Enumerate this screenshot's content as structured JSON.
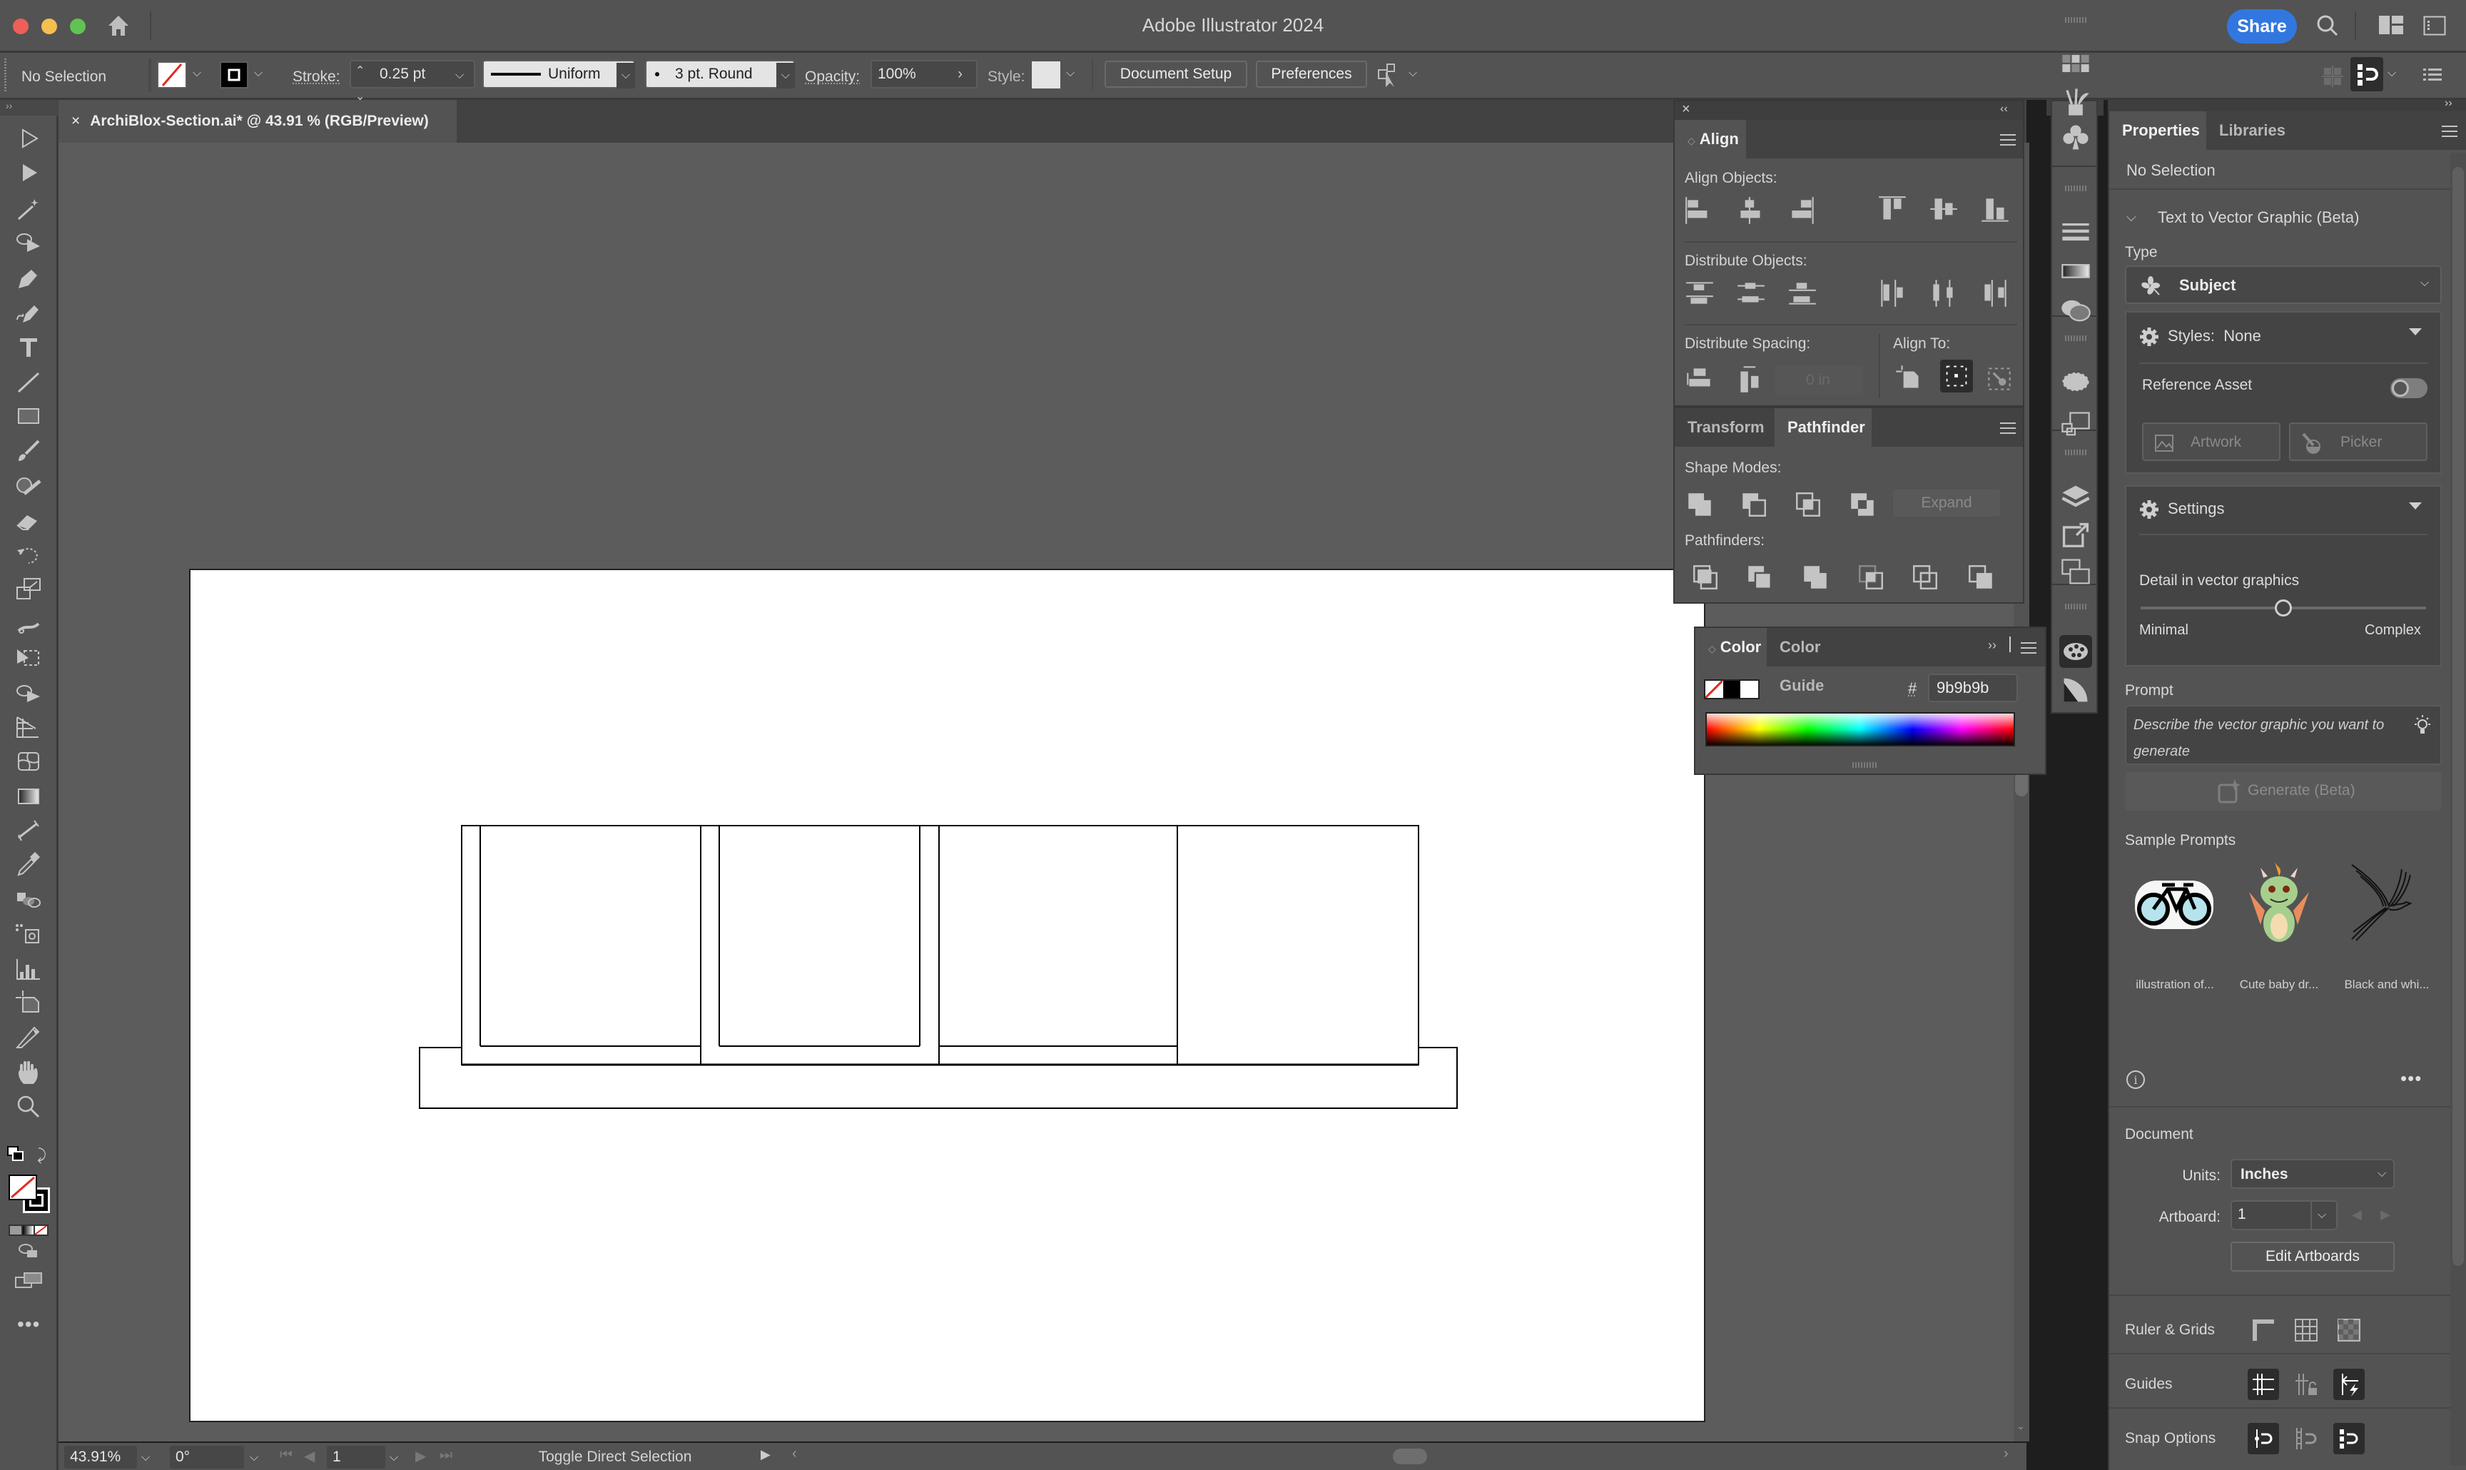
{
  "app": {
    "title": "Adobe Illustrator 2024",
    "share_label": "Share"
  },
  "control_bar": {
    "selection_status": "No Selection",
    "stroke_label": "Stroke:",
    "stroke_weight": "0.25 pt",
    "stroke_profile": "Uniform",
    "brush": "3 pt. Round",
    "opacity_label": "Opacity:",
    "opacity_value": "100%",
    "style_label": "Style:",
    "document_setup_label": "Document Setup",
    "preferences_label": "Preferences"
  },
  "document_tab": {
    "close_glyph": "×",
    "title": "ArchiBlox-Section.ai* @ 43.91 % (RGB/Preview)"
  },
  "tools": [
    {
      "name": "selection-tool"
    },
    {
      "name": "direct-selection-tool"
    },
    {
      "name": "magic-wand-tool"
    },
    {
      "name": "lasso-tool"
    },
    {
      "name": "pen-tool"
    },
    {
      "name": "curvature-tool"
    },
    {
      "name": "type-tool"
    },
    {
      "name": "line-segment-tool"
    },
    {
      "name": "rectangle-tool"
    },
    {
      "name": "paintbrush-tool"
    },
    {
      "name": "shaper-tool"
    },
    {
      "name": "eraser-tool"
    },
    {
      "name": "rotate-tool"
    },
    {
      "name": "scale-tool"
    },
    {
      "name": "puppet-warp-tool"
    },
    {
      "name": "free-transform-tool"
    },
    {
      "name": "shape-builder-tool"
    },
    {
      "name": "perspective-grid-tool"
    },
    {
      "name": "mesh-tool"
    },
    {
      "name": "gradient-tool"
    },
    {
      "name": "measure-tool"
    },
    {
      "name": "eyedropper-tool"
    },
    {
      "name": "blend-tool"
    },
    {
      "name": "symbol-sprayer-tool"
    },
    {
      "name": "column-graph-tool"
    },
    {
      "name": "artboard-tool"
    },
    {
      "name": "slice-tool"
    },
    {
      "name": "hand-tool"
    },
    {
      "name": "zoom-tool"
    }
  ],
  "status_bar": {
    "zoom": "43.91%",
    "rotation": "0°",
    "artboard_number": "1",
    "current_tool_hint": "Toggle Direct Selection"
  },
  "align_panel": {
    "tab_label": "Align",
    "align_objects_label": "Align Objects:",
    "distribute_objects_label": "Distribute Objects:",
    "distribute_spacing_label": "Distribute Spacing:",
    "spacing_value": "0 in",
    "align_to_label": "Align To:"
  },
  "pathfinder_panel": {
    "tabs": [
      "Transform",
      "Pathfinder"
    ],
    "active_tab": "Pathfinder",
    "shape_modes_label": "Shape Modes:",
    "expand_label": "Expand",
    "pathfinders_label": "Pathfinders:"
  },
  "color_panel": {
    "tabs": [
      "Color",
      "Color Guide"
    ],
    "active_tab": "Color",
    "hash_label": "#",
    "hex_value": "9b9b9b"
  },
  "properties_panel": {
    "tabs": [
      "Properties",
      "Libraries"
    ],
    "active_tab": "Properties",
    "selection_status": "No Selection",
    "text_to_vector": {
      "section_title": "Text to Vector Graphic (Beta)",
      "type_label": "Type",
      "type_value": "Subject",
      "styles_label": "Styles:",
      "styles_value": "None",
      "reference_asset_label": "Reference Asset",
      "reference_asset_enabled": false,
      "artwork_label": "Artwork",
      "picker_label": "Picker",
      "settings_label": "Settings",
      "detail_label": "Detail in vector graphics",
      "detail_min_label": "Minimal",
      "detail_max_label": "Complex",
      "detail_value": 0.5,
      "prompt_label": "Prompt",
      "prompt_placeholder": "Describe the vector graphic you want to generate",
      "generate_label": "Generate (Beta)",
      "sample_prompts_label": "Sample Prompts",
      "sample_prompts": [
        {
          "caption": "illustration of...",
          "icon": "bicycle-icon"
        },
        {
          "caption": "Cute baby dr...",
          "icon": "dragon-icon"
        },
        {
          "caption": "Black and whi...",
          "icon": "bird-icon"
        }
      ]
    },
    "document": {
      "section_title": "Document",
      "units_label": "Units:",
      "units_value": "Inches",
      "artboard_label": "Artboard:",
      "artboard_value": "1",
      "edit_artboards_label": "Edit Artboards"
    },
    "ruler_grids_label": "Ruler & Grids",
    "guides_label": "Guides",
    "snap_options_label": "Snap Options"
  },
  "colors": {
    "accent": "#3277df",
    "fill_none_slash": "#e02a22",
    "hex_swatch": "#9b9b9b"
  }
}
